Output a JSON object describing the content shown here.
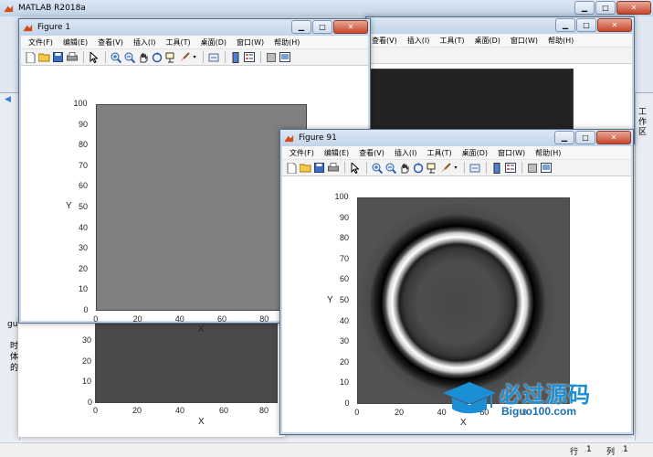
{
  "main_window": {
    "title": "MATLAB R2018a"
  },
  "status_bar": {
    "row_label": "行",
    "row_value": "1",
    "col_label": "列",
    "col_value": "1"
  },
  "side_panel": {
    "label": "工作区"
  },
  "left_fragments": {
    "a": "gu",
    "b": "时",
    "c": "体",
    "d": "的"
  },
  "figure1": {
    "title": "Figure 1",
    "menu": [
      "文件(F)",
      "编辑(E)",
      "查看(V)",
      "插入(I)",
      "工具(T)",
      "桌面(D)",
      "窗口(W)",
      "帮助(H)"
    ],
    "y_ticks": [
      "100",
      "90",
      "80",
      "70",
      "60",
      "50",
      "40",
      "30",
      "20",
      "10",
      "0"
    ],
    "x_ticks": [
      "0",
      "20",
      "40",
      "60",
      "80"
    ],
    "xlabel": "X",
    "ylabel": "Y",
    "fill_color": "#808080"
  },
  "figure_behind": {
    "y_ticks": [
      "30",
      "20",
      "10",
      "0"
    ],
    "x_ticks": [
      "0",
      "20",
      "40",
      "60",
      "80"
    ],
    "xlabel": "X"
  },
  "figure91": {
    "title": "Figure 91",
    "menu": [
      "文件(F)",
      "编辑(E)",
      "查看(V)",
      "插入(I)",
      "工具(T)",
      "桌面(D)",
      "窗口(W)",
      "帮助(H)"
    ],
    "y_ticks": [
      "100",
      "90",
      "80",
      "70",
      "60",
      "50",
      "40",
      "30",
      "20",
      "10",
      "0"
    ],
    "x_ticks": [
      "0",
      "20",
      "40",
      "60",
      "80"
    ],
    "xlabel": "X",
    "ylabel": "Y"
  },
  "watermark": {
    "brand": "必过源码",
    "url": "Biguo100.com"
  },
  "colors": {
    "accent": "#1a8fd6",
    "title_bg": "#c9d9ea",
    "matlab_red": "#d64b1c"
  },
  "icons": [
    "new-file-icon",
    "open-folder-icon",
    "save-icon",
    "print-icon",
    "pointer-icon",
    "zoom-in-icon",
    "zoom-out-icon",
    "pan-icon",
    "rotate-icon",
    "data-cursor-icon",
    "brush-icon",
    "link-icon",
    "colorbar-icon",
    "legend-icon",
    "grid-icon",
    "dock-icon"
  ]
}
